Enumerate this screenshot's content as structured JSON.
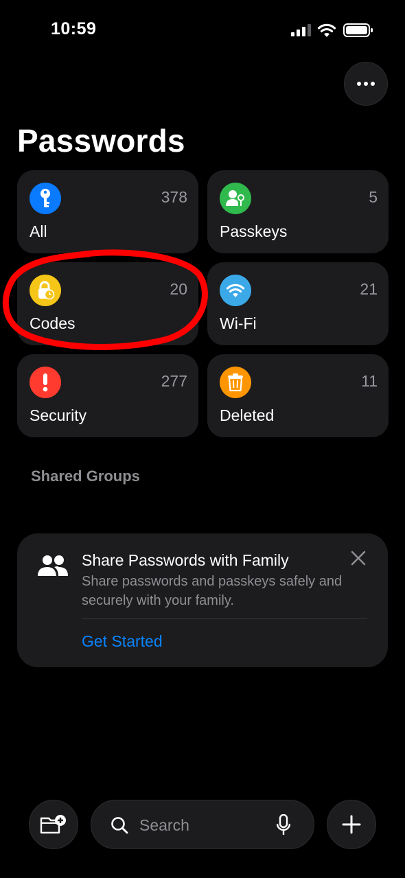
{
  "status_bar": {
    "time": "10:59"
  },
  "header": {
    "title": "Passwords"
  },
  "tiles": [
    {
      "label": "All",
      "count": "378",
      "icon": "key-icon",
      "color": "#0a7aff"
    },
    {
      "label": "Passkeys",
      "count": "5",
      "icon": "person-key-icon",
      "color": "#30b94c"
    },
    {
      "label": "Codes",
      "count": "20",
      "icon": "lock-clock-icon",
      "color": "#f5c518"
    },
    {
      "label": "Wi-Fi",
      "count": "21",
      "icon": "wifi-icon",
      "color": "#3ba9e8"
    },
    {
      "label": "Security",
      "count": "277",
      "icon": "exclamation-icon",
      "color": "#ff3b30"
    },
    {
      "label": "Deleted",
      "count": "11",
      "icon": "trash-icon",
      "color": "#ff9500"
    }
  ],
  "annotation": {
    "color": "#ff0000",
    "target": "Codes"
  },
  "shared_groups": {
    "label": "Shared Groups"
  },
  "share_card": {
    "title": "Share Passwords with Family",
    "body": "Share passwords and passkeys safely and securely with your family.",
    "link": "Get Started",
    "link_color": "#0a84ff"
  },
  "bottom_bar": {
    "search_placeholder": "Search"
  }
}
